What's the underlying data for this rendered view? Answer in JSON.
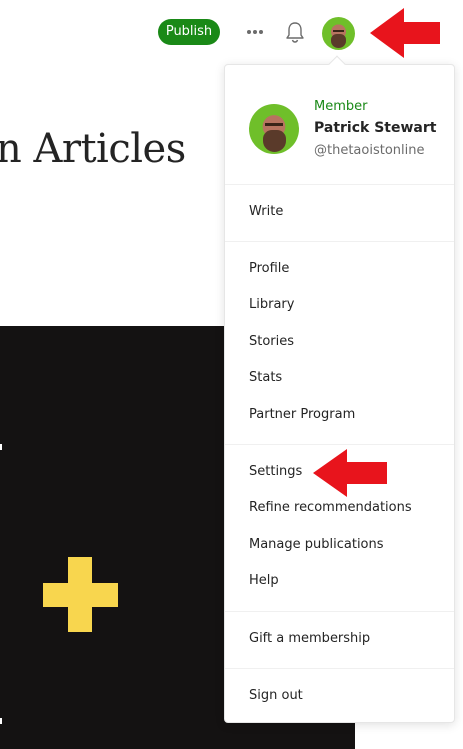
{
  "header": {
    "publish_label": "Publish",
    "more_icon": "more-horizontal-icon",
    "bell_icon": "notification-bell-icon",
    "avatar": "user-avatar"
  },
  "article": {
    "title_fragment": "n Articles"
  },
  "colors": {
    "accent_green": "#1a8917",
    "annotation_red": "#e8141c",
    "hero_background": "#141212",
    "plus_yellow": "#f8d64e"
  },
  "menu": {
    "profile": {
      "status": "Member",
      "name": "Patrick Stewart",
      "handle": "@thetaoistonline"
    },
    "items": [
      {
        "label": "Write"
      },
      {
        "label": "Profile"
      },
      {
        "label": "Library"
      },
      {
        "label": "Stories"
      },
      {
        "label": "Stats"
      },
      {
        "label": "Partner Program"
      },
      {
        "label": "Settings"
      },
      {
        "label": "Refine recommendations"
      },
      {
        "label": "Manage publications"
      },
      {
        "label": "Help"
      },
      {
        "label": "Gift a membership"
      },
      {
        "label": "Sign out"
      }
    ]
  }
}
